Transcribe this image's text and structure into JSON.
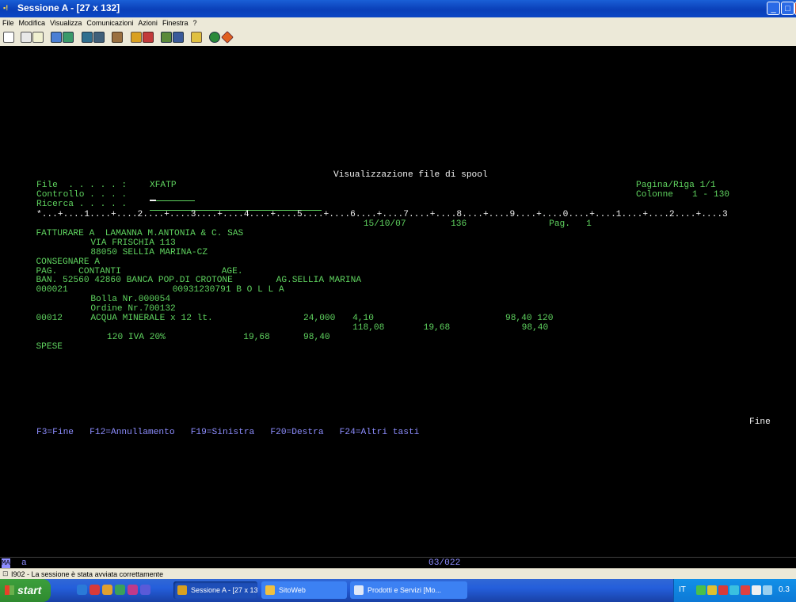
{
  "window": {
    "title": "Sessione A - [27 x 132]"
  },
  "menu": [
    "File",
    "Modifica",
    "Visualizza",
    "Comunicazioni",
    "Azioni",
    "Finestra",
    "?"
  ],
  "terminal": {
    "header_title": "Visualizzazione file di spool",
    "file_label": "File  . . . . . :",
    "file_value": "XFATP",
    "controllo_label": "Controllo . . . .",
    "ricerca_label": "Ricerca . . . . .",
    "pagina_label": "Pagina/Riga 1/1",
    "colonne_label": "Colonne",
    "colonne_value": "1 - 130",
    "ruler": "*...+....1....+....2....+....3....+....4....+....5....+....6....+....7....+....8....+....9....+....0....+....1....+....2....+....3",
    "report": [
      {
        "text": "15/10/07",
        "col": 65,
        "row": 0
      },
      {
        "text": "136",
        "col": 81,
        "row": 0
      },
      {
        "text": "Pag.   1",
        "col": 99,
        "row": 0
      },
      {
        "text": "FATTURARE A  LAMANNA M.ANTONIA & C. SAS",
        "col": 5,
        "row": 1
      },
      {
        "text": "VIA FRISCHIA 113",
        "col": 15,
        "row": 2
      },
      {
        "text": "88050 SELLIA MARINA-CZ",
        "col": 15,
        "row": 3
      },
      {
        "text": "CONSEGNARE A",
        "col": 5,
        "row": 4
      },
      {
        "text": "PAG.    CONTANTI",
        "col": 5,
        "row": 5
      },
      {
        "text": "AGE.",
        "col": 39,
        "row": 5
      },
      {
        "text": "BAN. 52560 42860 BANCA POP.DI CROTONE",
        "col": 5,
        "row": 6
      },
      {
        "text": "AG.SELLIA MARINA",
        "col": 49,
        "row": 6
      },
      {
        "text": "000021",
        "col": 5,
        "row": 7
      },
      {
        "text": "00931230791 B O L L A",
        "col": 30,
        "row": 7
      },
      {
        "text": "Bolla Nr.000054",
        "col": 15,
        "row": 8
      },
      {
        "text": "Ordine Nr.700132",
        "col": 15,
        "row": 9
      },
      {
        "text": "00012",
        "col": 5,
        "row": 10
      },
      {
        "text": "ACQUA MINERALE x 12 lt.",
        "col": 15,
        "row": 10
      },
      {
        "text": "24,000",
        "col": 54,
        "row": 10
      },
      {
        "text": "4,10",
        "col": 63,
        "row": 10
      },
      {
        "text": "98,40 120",
        "col": 91,
        "row": 10
      },
      {
        "text": "118,08",
        "col": 63,
        "row": 11
      },
      {
        "text": "19,68",
        "col": 76,
        "row": 11
      },
      {
        "text": "98,40",
        "col": 94,
        "row": 11
      },
      {
        "text": "120 IVA 20%",
        "col": 18,
        "row": 12
      },
      {
        "text": "19,68",
        "col": 43,
        "row": 12
      },
      {
        "text": "98,40",
        "col": 54,
        "row": 12
      },
      {
        "text": "SPESE",
        "col": 5,
        "row": 13
      }
    ],
    "fine_label": "Fine",
    "fkeys": "F3=Fine   F12=Annullamento   F19=Sinistra   F20=Destra   F24=Altri tasti",
    "oia_mode": "MA",
    "oia_session": "a",
    "oia_position": "03/022"
  },
  "statusbar": {
    "message": "I902 - La sessione è stata avviata correttamente"
  },
  "taskbar": {
    "start_label": "start",
    "tasks": [
      "Sessione A - [27 x 132]",
      "SitoWeb",
      "Prodotti e Servizi [Mo..."
    ],
    "tray_lang": "IT",
    "clock": "0.3"
  },
  "colors": {
    "terminal_bg": "#000000",
    "green": "#5fd35f",
    "white": "#f2f2f2",
    "blue": "#8d8dff",
    "titlebar": "#0a3fb8"
  }
}
